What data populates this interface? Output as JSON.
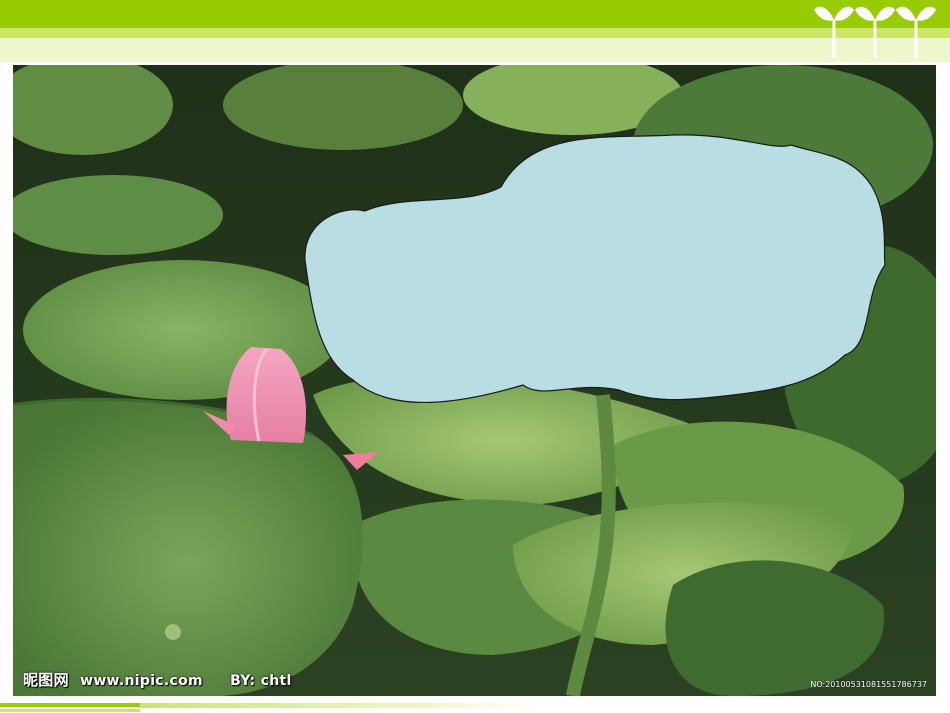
{
  "colors": {
    "primary_green": "#99CC00",
    "light_green": "#CCE566",
    "pale_green": "#EEF6CC",
    "lily_pad_green": "#5E8E46",
    "blob_fill": "#B8DDE3",
    "lotus_pink": "#EE8FAE"
  },
  "icons": {
    "sprout": "sprout-icon"
  },
  "photo": {
    "subject": "lotus-bud-and-leaves-image",
    "watermark": {
      "brand": "昵图网",
      "url": "www.nipic.com",
      "author": "BY: chtl",
      "id": "NO:20100531081551786737"
    }
  },
  "text_blob": {
    "text": ""
  }
}
